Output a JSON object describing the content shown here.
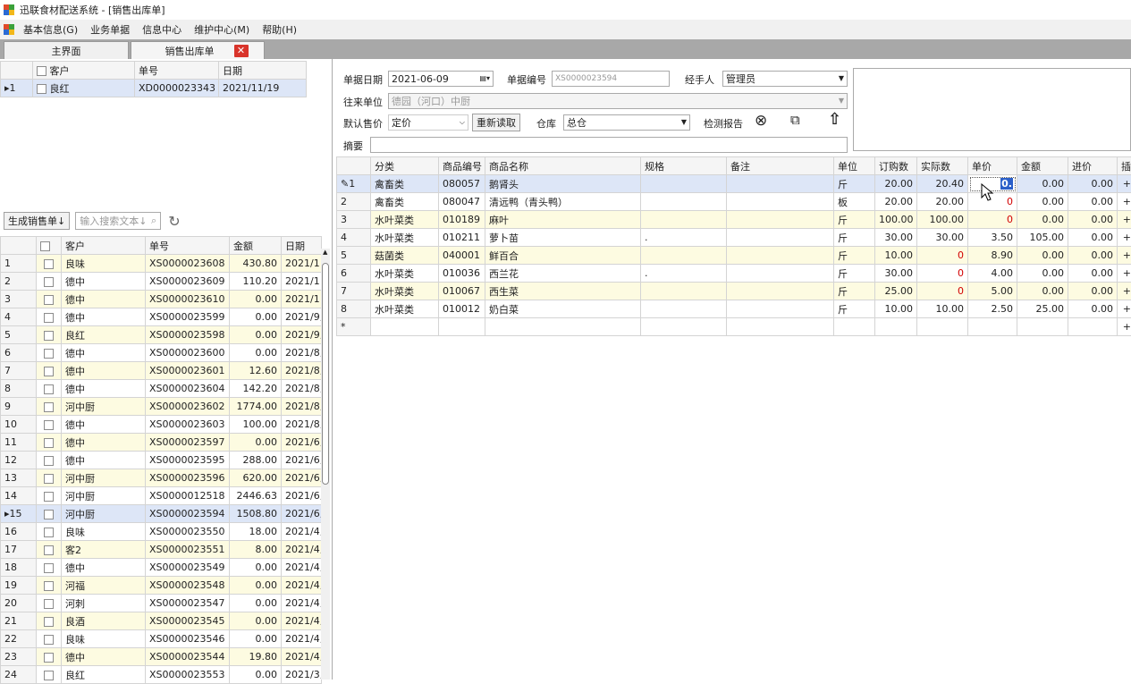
{
  "window": {
    "title": "迅联食材配送系统 - [销售出库单]"
  },
  "menu": [
    "基本信息(G)",
    "业务单据",
    "信息中心",
    "维护中心(M)",
    "帮助(H)"
  ],
  "tabs": [
    "主界面",
    "销售出库单"
  ],
  "top_grid": {
    "headers": [
      "客户",
      "单号",
      "日期"
    ],
    "rows": [
      {
        "n": "1",
        "customer": "良红",
        "no": "XD0000023343",
        "date": "2021/11/19"
      }
    ]
  },
  "toolbar": {
    "generate_label": "生成销售单↓",
    "search_placeholder": "输入搜索文本↓"
  },
  "order_list": {
    "headers": [
      "客户",
      "单号",
      "金额",
      "日期"
    ],
    "rows": [
      {
        "n": "1",
        "customer": "良味",
        "no": "XS0000023608",
        "amount": "430.80",
        "date": "2021/1"
      },
      {
        "n": "2",
        "customer": "德中",
        "no": "XS0000023609",
        "amount": "110.20",
        "date": "2021/1"
      },
      {
        "n": "3",
        "customer": "德中",
        "no": "XS0000023610",
        "amount": "0.00",
        "date": "2021/1"
      },
      {
        "n": "4",
        "customer": "德中",
        "no": "XS0000023599",
        "amount": "0.00",
        "date": "2021/9,"
      },
      {
        "n": "5",
        "customer": "良红",
        "no": "XS0000023598",
        "amount": "0.00",
        "date": "2021/9,"
      },
      {
        "n": "6",
        "customer": "德中",
        "no": "XS0000023600",
        "amount": "0.00",
        "date": "2021/8,"
      },
      {
        "n": "7",
        "customer": "德中",
        "no": "XS0000023601",
        "amount": "12.60",
        "date": "2021/8,"
      },
      {
        "n": "8",
        "customer": "德中",
        "no": "XS0000023604",
        "amount": "142.20",
        "date": "2021/8,"
      },
      {
        "n": "9",
        "customer": "河中厨",
        "no": "XS0000023602",
        "amount": "1774.00",
        "date": "2021/8,"
      },
      {
        "n": "10",
        "customer": "德中",
        "no": "XS0000023603",
        "amount": "100.00",
        "date": "2021/8,"
      },
      {
        "n": "11",
        "customer": "德中",
        "no": "XS0000023597",
        "amount": "0.00",
        "date": "2021/6,"
      },
      {
        "n": "12",
        "customer": "德中",
        "no": "XS0000023595",
        "amount": "288.00",
        "date": "2021/6,"
      },
      {
        "n": "13",
        "customer": "河中厨",
        "no": "XS0000023596",
        "amount": "620.00",
        "date": "2021/6,"
      },
      {
        "n": "14",
        "customer": "河中厨",
        "no": "XS0000012518",
        "amount": "2446.63",
        "date": "2021/6,"
      },
      {
        "n": "15",
        "customer": "河中厨",
        "no": "XS0000023594",
        "amount": "1508.80",
        "date": "2021/6,"
      },
      {
        "n": "16",
        "customer": "良味",
        "no": "XS0000023550",
        "amount": "18.00",
        "date": "2021/4,"
      },
      {
        "n": "17",
        "customer": "客2",
        "no": "XS0000023551",
        "amount": "8.00",
        "date": "2021/4,"
      },
      {
        "n": "18",
        "customer": "德中",
        "no": "XS0000023549",
        "amount": "0.00",
        "date": "2021/4,"
      },
      {
        "n": "19",
        "customer": "河福",
        "no": "XS0000023548",
        "amount": "0.00",
        "date": "2021/4,"
      },
      {
        "n": "20",
        "customer": "河刺",
        "no": "XS0000023547",
        "amount": "0.00",
        "date": "2021/4,"
      },
      {
        "n": "21",
        "customer": "良酒",
        "no": "XS0000023545",
        "amount": "0.00",
        "date": "2021/4,"
      },
      {
        "n": "22",
        "customer": "良味",
        "no": "XS0000023546",
        "amount": "0.00",
        "date": "2021/4,"
      },
      {
        "n": "23",
        "customer": "德中",
        "no": "XS0000023544",
        "amount": "19.80",
        "date": "2021/4,"
      },
      {
        "n": "24",
        "customer": "良红",
        "no": "XS0000023553",
        "amount": "0.00",
        "date": "2021/3,"
      }
    ]
  },
  "form": {
    "date_label": "单据日期",
    "date_value": "2021-06-09",
    "docno_label": "单据编号",
    "docno_value": "XS0000023594",
    "handler_label": "经手人",
    "handler_value": "管理员",
    "partner_label": "往来单位",
    "partner_value": "德园（河口）中厨",
    "price_label": "默认售价",
    "price_value": "定价",
    "reload_label": "重新读取",
    "warehouse_label": "仓库",
    "warehouse_value": "总仓",
    "report_label": "检测报告",
    "summary_label": "摘要"
  },
  "detail": {
    "headers": [
      "分类",
      "商品编号",
      "商品名称",
      "规格",
      "备注",
      "单位",
      "订购数",
      "实际数",
      "单价",
      "金额",
      "进价",
      "插"
    ],
    "rows": [
      {
        "n": "1",
        "cat": "禽畜类",
        "code": "080057",
        "name": "鹅肾头",
        "spec": "",
        "note": "",
        "unit": "斤",
        "order": "20.00",
        "actual": "20.40",
        "price": "0.",
        "amount": "0.00",
        "cost": "0.00",
        "ins": "+"
      },
      {
        "n": "2",
        "cat": "禽畜类",
        "code": "080047",
        "name": "清远鸭（青头鸭）",
        "spec": "",
        "note": "",
        "unit": "板",
        "order": "20.00",
        "actual": "20.00",
        "price": "0",
        "amount": "0.00",
        "cost": "0.00",
        "ins": "+"
      },
      {
        "n": "3",
        "cat": "水叶菜类",
        "code": "010189",
        "name": "麻叶",
        "spec": "",
        "note": "",
        "unit": "斤",
        "order": "100.00",
        "actual": "100.00",
        "price": "0",
        "amount": "0.00",
        "cost": "0.00",
        "ins": "+"
      },
      {
        "n": "4",
        "cat": "水叶菜类",
        "code": "010211",
        "name": "萝卜苗",
        "spec": ".",
        "note": "",
        "unit": "斤",
        "order": "30.00",
        "actual": "30.00",
        "price": "3.50",
        "amount": "105.00",
        "cost": "0.00",
        "ins": "+"
      },
      {
        "n": "5",
        "cat": "菇菌类",
        "code": "040001",
        "name": "鲜百合",
        "spec": "",
        "note": "",
        "unit": "斤",
        "order": "10.00",
        "actual": "0",
        "price": "8.90",
        "amount": "0.00",
        "cost": "0.00",
        "ins": "+"
      },
      {
        "n": "6",
        "cat": "水叶菜类",
        "code": "010036",
        "name": "西兰花",
        "spec": ".",
        "note": "",
        "unit": "斤",
        "order": "30.00",
        "actual": "0",
        "price": "4.00",
        "amount": "0.00",
        "cost": "0.00",
        "ins": "+"
      },
      {
        "n": "7",
        "cat": "水叶菜类",
        "code": "010067",
        "name": "西生菜",
        "spec": "",
        "note": "",
        "unit": "斤",
        "order": "25.00",
        "actual": "0",
        "price": "5.00",
        "amount": "0.00",
        "cost": "0.00",
        "ins": "+"
      },
      {
        "n": "8",
        "cat": "水叶菜类",
        "code": "010012",
        "name": "奶白菜",
        "spec": "",
        "note": "",
        "unit": "斤",
        "order": "10.00",
        "actual": "10.00",
        "price": "2.50",
        "amount": "25.00",
        "cost": "0.00",
        "ins": "+"
      }
    ],
    "new_row_marker": "*"
  },
  "colors": {
    "accent_red": "#d20000",
    "row_alt": "#fdfbe1",
    "row_selected": "#dde6f7",
    "close_tab": "#d9342b"
  }
}
